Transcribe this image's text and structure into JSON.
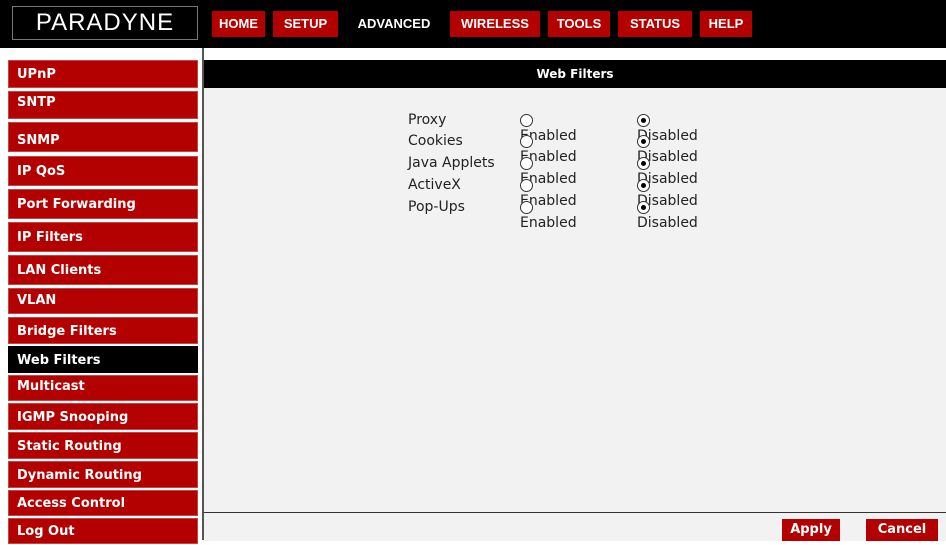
{
  "brand": {
    "logo_text": "PARADYNE"
  },
  "nav": {
    "tabs": [
      {
        "label": "HOME"
      },
      {
        "label": "SETUP"
      },
      {
        "label": "ADVANCED"
      },
      {
        "label": "WIRELESS"
      },
      {
        "label": "TOOLS"
      },
      {
        "label": "STATUS"
      },
      {
        "label": "HELP"
      }
    ],
    "active_tab": "ADVANCED"
  },
  "sidebar": {
    "items": [
      {
        "label": "UPnP"
      },
      {
        "label": "SNTP"
      },
      {
        "label": "SNMP"
      },
      {
        "label": "IP QoS"
      },
      {
        "label": "Port Forwarding"
      },
      {
        "label": "IP Filters"
      },
      {
        "label": "LAN Clients"
      },
      {
        "label": "VLAN"
      },
      {
        "label": "Bridge Filters"
      },
      {
        "label": "Web Filters"
      },
      {
        "label": "Multicast"
      },
      {
        "label": "IGMP Snooping"
      },
      {
        "label": "Static Routing"
      },
      {
        "label": "Dynamic Routing"
      },
      {
        "label": "Access Control"
      },
      {
        "label": "Log Out"
      }
    ],
    "active_item": "Web Filters"
  },
  "main": {
    "header": "Web Filters",
    "options": [
      {
        "label": "Proxy",
        "enabled_label": "Enabled",
        "disabled_label": "Disabled",
        "value": "Disabled"
      },
      {
        "label": "Cookies",
        "enabled_label": "Enabled",
        "disabled_label": "Disabled",
        "value": "Disabled"
      },
      {
        "label": "Java Applets",
        "enabled_label": "Enabled",
        "disabled_label": "Disabled",
        "value": "Disabled"
      },
      {
        "label": "ActiveX",
        "enabled_label": "Enabled",
        "disabled_label": "Disabled",
        "value": "Disabled"
      },
      {
        "label": "Pop-Ups",
        "enabled_label": "Enabled",
        "disabled_label": "Disabled",
        "value": "Disabled"
      }
    ]
  },
  "footer": {
    "apply_label": "Apply",
    "cancel_label": "Cancel"
  },
  "colors": {
    "accent_red": "#b30000",
    "black": "#000000",
    "panel": "#f2f2f2"
  }
}
